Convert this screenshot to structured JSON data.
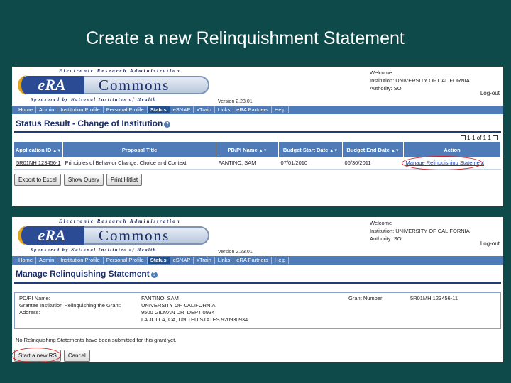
{
  "slide_title": "Create a new Relinquishment Statement",
  "era": {
    "logo_top": "Electronic Research Administration",
    "logo_era": "eRA",
    "logo_commons": "Commons",
    "logo_bottom": "Sponsored by National Institutes of Health",
    "version": "Version 2.23.01",
    "version_2": "Version 2.23.01",
    "welcome": "Welcome",
    "institution": "Institution: UNIVERSITY OF CALIFORNIA",
    "authority": "Authority:   SO",
    "logout": "Log-out"
  },
  "nav": [
    "Home",
    "Admin",
    "Institution Profile",
    "Personal Profile",
    "Status",
    "eSNAP",
    "xTrain",
    "Links",
    "eRA Partners",
    "Help"
  ],
  "shot1": {
    "title": "Status Result - Change of Institution",
    "pager_text": "1-1 of 1",
    "pager_right": "1",
    "columns": [
      "Application ID",
      "Proposal Title",
      "PD/PI Name",
      "Budget Start Date",
      "Budget End Date",
      "Action"
    ],
    "row": {
      "app_id": "5R01NH 123456-1",
      "title": "Principles of Behavior Change: Choice and Context",
      "pi": "FANTINO, SAM",
      "start": "07/01/2010",
      "end": "06/30/2011",
      "action": "Manage Relinquishing Statement"
    },
    "buttons": [
      "Export to Excel",
      "Show Query",
      "Print Hitlist"
    ]
  },
  "shot2": {
    "title": "Manage Relinquishing Statement",
    "pd_label": "PD/PI Name:",
    "pd_value": "FANTINO, SAM",
    "grantee_label": "Grantee Institution Relinquishing the Grant:",
    "grantee_value": "UNIVERSITY OF CALIFORNIA",
    "address_label": "Address:",
    "address_line1": "9500 GILMAN DR. DEPT 0934",
    "address_line2": "LA JOLLA, CA, UNITED STATES 920930934",
    "grant_number_label": "Grant Number:",
    "grant_number_value": "5R01MH 123456-11",
    "notice": "No Relinquishing Statements have been submitted for this grant yet.",
    "start_button": "Start a new RS",
    "cancel_button": "Cancel"
  },
  "colors": {
    "background": "#0e4a4a",
    "nav": "#4f7cb8",
    "highlight": "#d02020",
    "title_blue": "#1b2d6b"
  }
}
